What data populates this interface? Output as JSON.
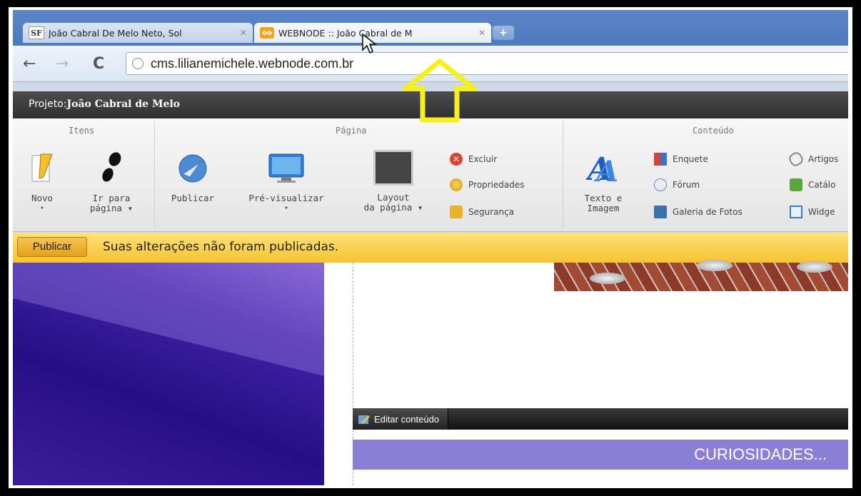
{
  "browser": {
    "tabs": [
      {
        "icon_text": "SF",
        "title": "João Cabral De Melo Neto, Sol"
      },
      {
        "icon_text": "oo",
        "title": "WEBNODE :: João Cabral de M"
      }
    ],
    "new_tab": "+",
    "url": "cms.lilianemichele.webnode.com.br"
  },
  "project": {
    "label": "Projeto:",
    "name": "João Cabral de Melo"
  },
  "ribbon": {
    "groups": [
      "Itens",
      "Página",
      "Conteúdo"
    ],
    "novo": "Novo",
    "ir_para_1": "Ir para",
    "ir_para_2": "página ▾",
    "publicar": "Publicar",
    "pre_visualizar": "Pré-visualizar",
    "layout_1": "Layout",
    "layout_2": "da página ▾",
    "excluir": "Excluir",
    "propriedades": "Propriedades",
    "seguranca": "Segurança",
    "texto_1": "Texto e",
    "texto_2": "Imagem",
    "enquete": "Enquete",
    "forum": "Fórum",
    "galeria": "Galeria de Fotos",
    "artigos": "Artigos",
    "catalogo": "Catálo",
    "widgets": "Widge"
  },
  "publish_bar": {
    "button": "Publicar",
    "message": "Suas alterações não foram publicadas."
  },
  "content": {
    "edit_label": "Editar conteúdo",
    "section_title": "CURIOSIDADES..."
  },
  "colors": {
    "annotation_arrow": "#f5f01c",
    "publish_bar": "#f6c32f",
    "section_header": "#8b7fd7"
  }
}
